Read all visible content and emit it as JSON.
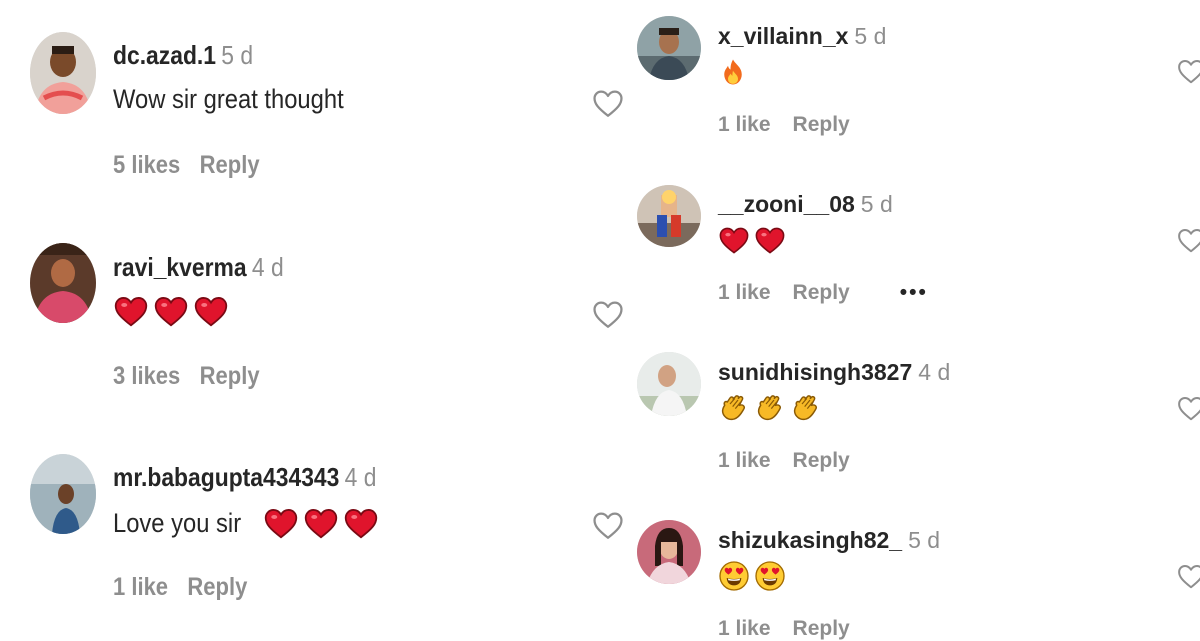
{
  "left_comments": [
    {
      "username": "dc.azad.1",
      "time": "5 d",
      "text": "Wow sir great thought",
      "emojis": [],
      "likes": "5 likes",
      "reply": "Reply"
    },
    {
      "username": "ravi_kverma",
      "time": "4 d",
      "text": "",
      "emojis": [
        "red-heart",
        "red-heart",
        "red-heart"
      ],
      "likes": "3 likes",
      "reply": "Reply"
    },
    {
      "username": "mr.babagupta434343",
      "time": "4 d",
      "text": "Love you sir",
      "emojis": [
        "red-heart",
        "red-heart",
        "red-heart"
      ],
      "likes": "1 like",
      "reply": "Reply"
    }
  ],
  "right_comments": [
    {
      "username": "x_villainn_x",
      "time": "5 d",
      "emojis": [
        "fire"
      ],
      "likes": "1 like",
      "reply": "Reply"
    },
    {
      "username": "__zooni__08",
      "time": "5 d",
      "emojis": [
        "red-heart",
        "red-heart"
      ],
      "likes": "1 like",
      "reply": "Reply",
      "more": "•••"
    },
    {
      "username": "sunidhisingh3827",
      "time": "4 d",
      "emojis": [
        "clapping-hands",
        "clapping-hands",
        "clapping-hands"
      ],
      "likes": "1 like",
      "reply": "Reply"
    },
    {
      "username": "shizukasingh82_",
      "time": "5 d",
      "emojis": [
        "heart-eyes-face",
        "heart-eyes-face"
      ],
      "likes": "1 like",
      "reply": "Reply"
    }
  ],
  "colors": {
    "text": "#262626",
    "muted": "#8e8e8e",
    "heart_red": "#e0142c"
  }
}
